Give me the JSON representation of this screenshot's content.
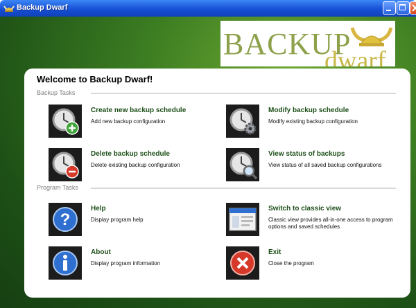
{
  "window": {
    "title": "Backup Dwarf"
  },
  "logo": {
    "line1": "BACKUP",
    "line2": "dwarf"
  },
  "panel": {
    "welcome": "Welcome to Backup Dwarf!",
    "sections": {
      "backup_tasks": "Backup Tasks",
      "program_tasks": "Program Tasks"
    },
    "tasks": [
      {
        "title": "Create new backup schedule",
        "desc": "Add new backup configuration",
        "icon": "clock-add-icon"
      },
      {
        "title": "Modify backup schedule",
        "desc": "Modify existing backup configuration",
        "icon": "clock-gear-icon"
      },
      {
        "title": "Delete backup schedule",
        "desc": "Delete existing backup configuration",
        "icon": "clock-remove-icon"
      },
      {
        "title": "View status of backups",
        "desc": "View status of all saved backup configurations",
        "icon": "clock-search-icon"
      },
      {
        "title": "Help",
        "desc": "Display program help",
        "icon": "help-icon"
      },
      {
        "title": "Switch to classic view",
        "desc": "Classic view provides all-in-one access to program options and saved schedules",
        "icon": "window-icon"
      },
      {
        "title": "About",
        "desc": "Display program information",
        "icon": "info-icon"
      },
      {
        "title": "Exit",
        "desc": "Close the program",
        "icon": "exit-icon"
      }
    ]
  }
}
